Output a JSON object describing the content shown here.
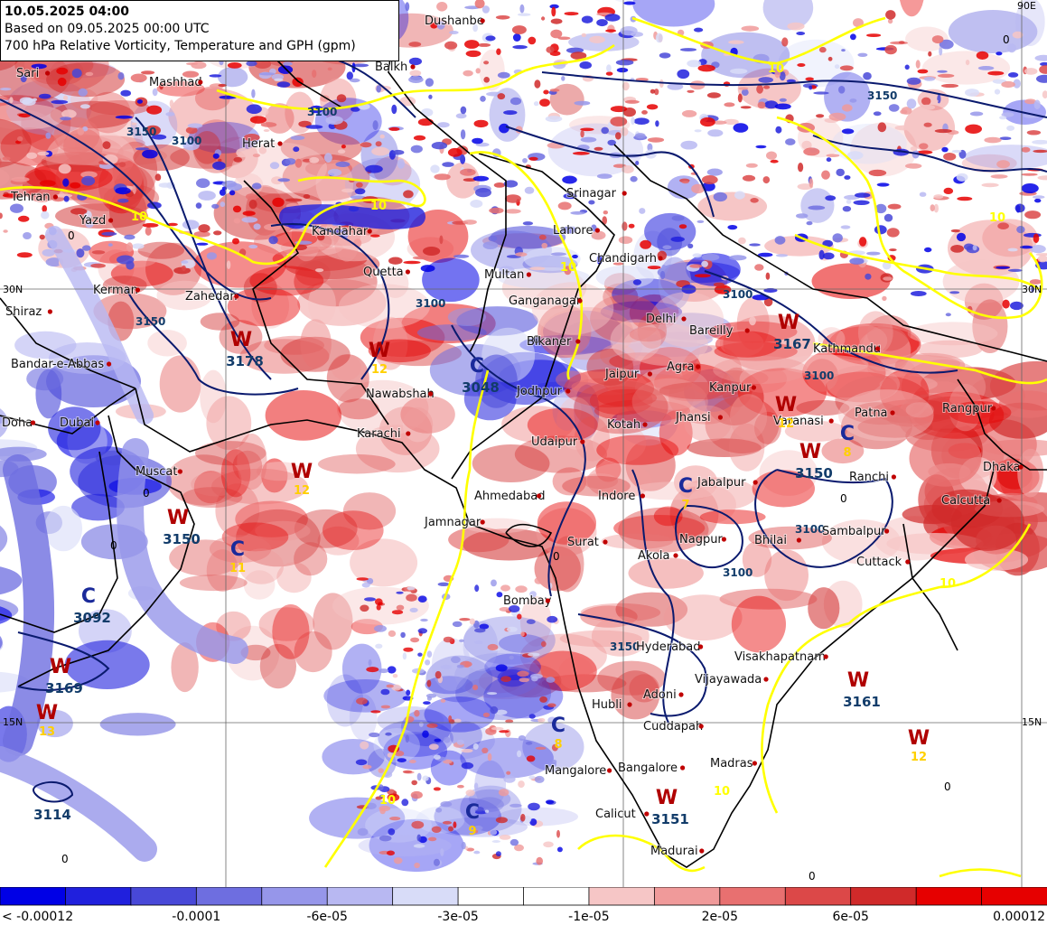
{
  "header": {
    "valid_time": "10.05.2025 04:00",
    "based_on": "Based on 09.05.2025 00:00 UTC",
    "title": "700 hPa Relative Vorticity, Temperature and GPH (gpm)"
  },
  "colors": {
    "neg_strong": "#0000e6",
    "pos_strong": "#e60000",
    "temp_contour": "#ffff00",
    "gph_contour": "#0a1a6e",
    "border": "#000000",
    "low_marker": "#1a2a9a",
    "high_marker": "#b00000",
    "marker_temp": "#ffd000",
    "gph_value": "#123c6a"
  },
  "lat_labels": {
    "n30_left": "30N",
    "n30_right": "30N",
    "n15_left": "15N",
    "n15_right": "15N",
    "e90": "90E"
  },
  "cities": [
    {
      "name": "Dushanbe"
    },
    {
      "name": "Balkh"
    },
    {
      "name": "Sari"
    },
    {
      "name": "Mashhad"
    },
    {
      "name": "Herat"
    },
    {
      "name": "Tehran"
    },
    {
      "name": "Yazd"
    },
    {
      "name": "Kandahar"
    },
    {
      "name": "Quetta"
    },
    {
      "name": "Kerman"
    },
    {
      "name": "Zahedan"
    },
    {
      "name": "Shiraz"
    },
    {
      "name": "Bandar-e-Abbas"
    },
    {
      "name": "Doha"
    },
    {
      "name": "Dubai"
    },
    {
      "name": "Muscat"
    },
    {
      "name": "Srinagar"
    },
    {
      "name": "Lahore"
    },
    {
      "name": "Chandigarh"
    },
    {
      "name": "Multan"
    },
    {
      "name": "Ganganagar"
    },
    {
      "name": "Delhi"
    },
    {
      "name": "Bareilly"
    },
    {
      "name": "Bikaner"
    },
    {
      "name": "Jaipur"
    },
    {
      "name": "Agra"
    },
    {
      "name": "Jodhpur"
    },
    {
      "name": "Kanpur"
    },
    {
      "name": "Nawabshah"
    },
    {
      "name": "Karachi"
    },
    {
      "name": "Kotah"
    },
    {
      "name": "Jhansi"
    },
    {
      "name": "Varanasi"
    },
    {
      "name": "Patna"
    },
    {
      "name": "Udaipur"
    },
    {
      "name": "Ranchi"
    },
    {
      "name": "Ahmedabad"
    },
    {
      "name": "Indore"
    },
    {
      "name": "Jabalpur"
    },
    {
      "name": "Calcutta"
    },
    {
      "name": "Jamnagar"
    },
    {
      "name": "Surat"
    },
    {
      "name": "Nagpur"
    },
    {
      "name": "Bhilai"
    },
    {
      "name": "Sambalpur"
    },
    {
      "name": "Akola"
    },
    {
      "name": "Cuttack"
    },
    {
      "name": "Bombay"
    },
    {
      "name": "Hyderabad"
    },
    {
      "name": "Visakhapatnam"
    },
    {
      "name": "Vijayawada"
    },
    {
      "name": "Adoni"
    },
    {
      "name": "Hubli"
    },
    {
      "name": "Cuddapah"
    },
    {
      "name": "Mangalore"
    },
    {
      "name": "Bangalore"
    },
    {
      "name": "Madras"
    },
    {
      "name": "Calicut"
    },
    {
      "name": "Madurai"
    },
    {
      "name": "Dhaka"
    },
    {
      "name": "Rangpur"
    },
    {
      "name": "Kathmandu"
    }
  ],
  "pressure_centers": [
    {
      "type": "W",
      "gph": "3178",
      "temp": ""
    },
    {
      "type": "W",
      "gph": "",
      "temp": "12"
    },
    {
      "type": "C",
      "gph": "3048",
      "temp": ""
    },
    {
      "type": "W",
      "gph": "3167",
      "temp": ""
    },
    {
      "type": "W",
      "gph": "",
      "temp": "12"
    },
    {
      "type": "W",
      "gph": "3150",
      "temp": ""
    },
    {
      "type": "C",
      "gph": "",
      "temp": "8"
    },
    {
      "type": "C",
      "gph": "",
      "temp": "7"
    },
    {
      "type": "W",
      "gph": "3150",
      "temp": ""
    },
    {
      "type": "C",
      "gph": "",
      "temp": "11"
    },
    {
      "type": "C",
      "gph": "3092",
      "temp": ""
    },
    {
      "type": "W",
      "gph": "3169",
      "temp": ""
    },
    {
      "type": "W",
      "gph": "",
      "temp": "13"
    },
    {
      "type": "W",
      "gph": "3161",
      "temp": ""
    },
    {
      "type": "W",
      "gph": "",
      "temp": "12"
    },
    {
      "type": "C",
      "gph": "",
      "temp": "8"
    },
    {
      "type": "C",
      "gph": "",
      "temp": "9"
    },
    {
      "type": "W",
      "gph": "3151",
      "temp": ""
    },
    {
      "type": "W",
      "gph": "",
      "temp": "12"
    }
  ],
  "unattached_gph": [
    "3114"
  ],
  "gph_contour_labels": [
    "3100",
    "3150",
    "3100",
    "3150",
    "3100",
    "3100",
    "3100",
    "3150",
    "3100",
    "3150",
    "3100"
  ],
  "temp_contour_labels": [
    "10",
    "10",
    "10",
    "10",
    "10",
    "10",
    "10",
    "10"
  ],
  "zero_labels": [
    "0",
    "0",
    "0",
    "0",
    "0",
    "0",
    "0",
    "0",
    "0",
    "0"
  ],
  "colorbar": {
    "colors": [
      "#0000e6",
      "#2020dd",
      "#4848d8",
      "#6e6ee0",
      "#9696ea",
      "#b8b8f2",
      "#d8dcf8",
      "#ffffff",
      "#ffffff",
      "#f6c6c6",
      "#f09a9a",
      "#e87070",
      "#dc4848",
      "#d02a2a",
      "#e60000",
      "#e60000"
    ],
    "labels": [
      "< -0.00012",
      "-0.0001",
      "-6e-05",
      "-3e-05",
      "-1e-05",
      "2e-05",
      "6e-05",
      "0.00012"
    ]
  }
}
